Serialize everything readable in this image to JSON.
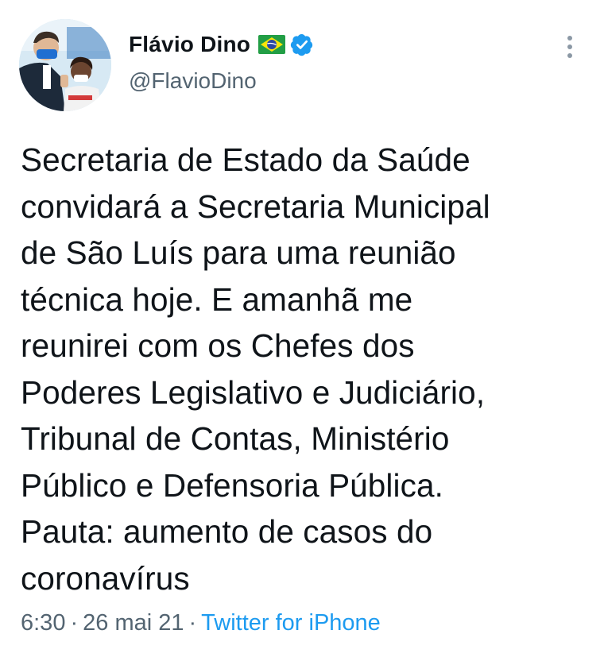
{
  "author": {
    "display_name": "Flávio Dino",
    "handle": "@FlavioDino",
    "flag_icon": "brazil-flag-icon",
    "verified_icon": "verified-badge-icon"
  },
  "tweet": {
    "text": "Secretaria de Estado da Saúde\nconvidará a Secretaria Municipal\nde São Luís para uma reunião\ntécnica hoje. E amanhã me\nreunirei com os Chefes dos\nPoderes Legislativo e Judiciário,\nTribunal de Contas, Ministério\nPúblico e Defensoria Pública.\nPauta: aumento de casos do\ncoronavírus",
    "time": "6:30",
    "separator": "·",
    "date": "26 mai 21",
    "source": "Twitter for iPhone"
  },
  "menu_icon": "more-vertical-icon",
  "colors": {
    "text_primary": "#0f1419",
    "text_secondary": "#536471",
    "link": "#1d9bf0",
    "verified": "#1d9bf0"
  }
}
